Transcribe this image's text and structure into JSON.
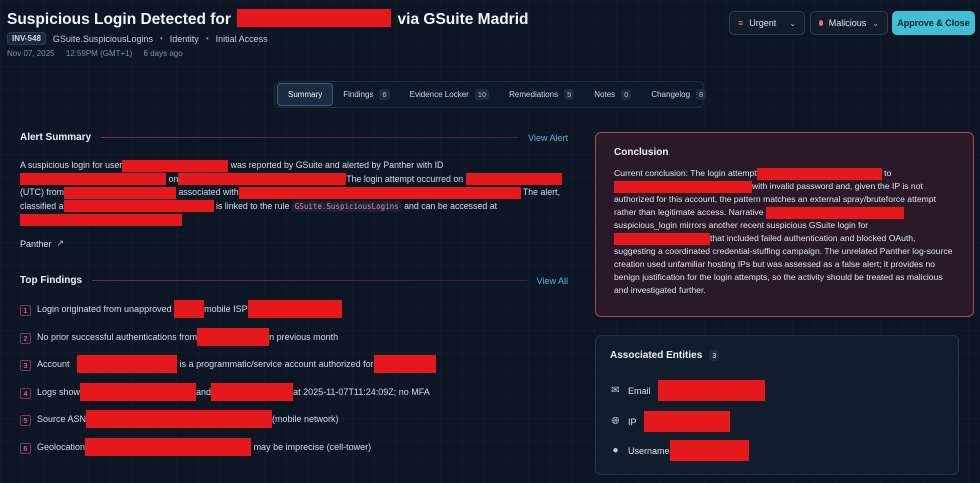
{
  "header": {
    "title_prefix": "Suspicious Login Detected for",
    "title_suffix": "via GSuite Madrid",
    "inv_id": "INV-548",
    "rule": "GSuite.SuspiciousLogins",
    "category": "Identity",
    "tactic": "Initial Access",
    "date": "Nov 07, 2025",
    "time": "12:59PM (GMT+1)",
    "age": "6 days ago",
    "severity_label": "Urgent",
    "verdict_label": "Malicious",
    "approve_label": "Approve & Close",
    "colors": {
      "accent": "#3fc1d3",
      "urgent": "#f07b4b",
      "malicious": "#f06a8b",
      "redaction": "#e5191c"
    }
  },
  "tabs": [
    {
      "label": "Summary",
      "count": ""
    },
    {
      "label": "Findings",
      "count": "6"
    },
    {
      "label": "Evidence Locker",
      "count": "10"
    },
    {
      "label": "Remediations",
      "count": "5"
    },
    {
      "label": "Notes",
      "count": "0"
    },
    {
      "label": "Changelog",
      "count": "8"
    }
  ],
  "alert_summary": {
    "heading": "Alert Summary",
    "link": "View Alert",
    "t1": "A suspicious login for user",
    "t2": "was reported by GSuite and alerted by Panther with ID",
    "t3": "on",
    "t4": "The login attempt occurred on",
    "t5": "(UTC) from",
    "t6": "associated with",
    "t7": "The alert,",
    "t8": "classified a",
    "t9": "is linked to the rule",
    "rule_code": "GSuite.SuspiciousLogins",
    "t10": "and can be accessed at",
    "source_link": "Panther"
  },
  "top_findings": {
    "heading": "Top Findings",
    "link": "View All",
    "items": [
      {
        "num": "1",
        "a": "Login originated from unapproved",
        "b": "mobile ISP",
        "c": ""
      },
      {
        "num": "2",
        "a": "No prior successful authentications from",
        "b": "n previous month",
        "c": ""
      },
      {
        "num": "3",
        "a": "Account",
        "b": "is a programmatic/service account authorized for",
        "c": ""
      },
      {
        "num": "4",
        "a": "Logs show",
        "b": "and",
        "c": "at 2025-11-07T11:24:09Z; no MFA"
      },
      {
        "num": "5",
        "a": "Source ASN",
        "b": "(mobile network)",
        "c": ""
      },
      {
        "num": "6",
        "a": "Geolocation",
        "b": "may be imprecise (cell-tower)",
        "c": ""
      }
    ]
  },
  "conclusion": {
    "heading": "Conclusion",
    "c1": "Current conclusion: The login attempt",
    "c2": "to",
    "c3": "with invalid password and, given the IP is not authorized for this account, the pattern matches an external spray/bruteforce attempt rather than legitimate access. Narrative",
    "c4": "suspicious_login mirrors another recent suspicious GSuite login for",
    "c5": "that included failed authentication and blocked OAuth, suggesting a coordinated credential-stuffing campaign. The unrelated Panther log-source creation used unfamiliar hosting IPs but was assessed as a false alert; it provides no benign justification for the login attempts, so the activity should be treated as malicious and investigated further."
  },
  "entities": {
    "heading": "Associated Entities",
    "count": "3",
    "items": [
      {
        "label": "Email",
        "icon": "envelope-icon"
      },
      {
        "label": "IP",
        "icon": "globe-icon"
      },
      {
        "label": "Username",
        "icon": "user-icon"
      }
    ]
  }
}
